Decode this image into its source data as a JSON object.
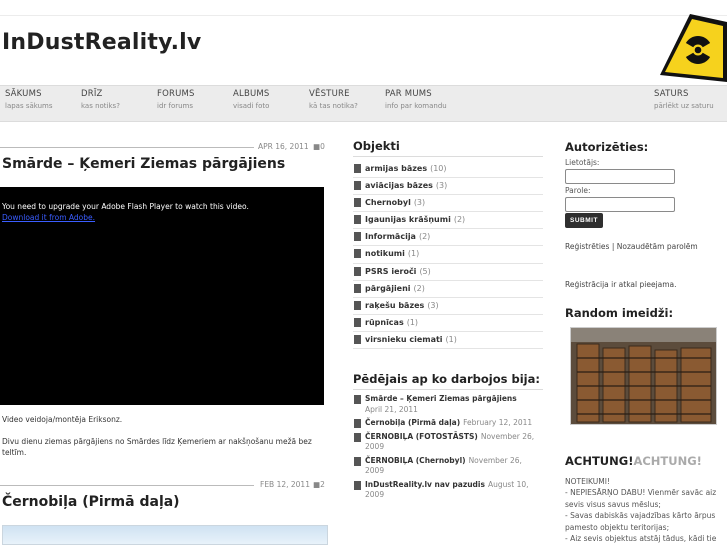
{
  "site": {
    "title": "InDustReality.lv"
  },
  "nav": [
    {
      "title": "SĀKUMS",
      "sub": "lapas sākums"
    },
    {
      "title": "DRĪZ",
      "sub": "kas notiks?"
    },
    {
      "title": "FORUMS",
      "sub": "idr forums"
    },
    {
      "title": "ALBUMS",
      "sub": "visadi foto"
    },
    {
      "title": "VĒSTURE",
      "sub": "kā tas notika?"
    },
    {
      "title": "PAR MUMS",
      "sub": "info par komandu"
    },
    {
      "title": "SATURS",
      "sub": "pārlēkt uz saturu"
    }
  ],
  "posts": [
    {
      "date": "APR 16, 2011",
      "comments": "0",
      "title": "Smārde – Ķemeri Ziemas pārgājiens",
      "video_msg": "You need to upgrade your Adobe Flash Player to watch this video.",
      "video_link": "Download it from Adobe.",
      "credit": "Video veidoja/montēja Eriksonz.",
      "body": "Divu dienu ziemas pārgājiens no Smārdes līdz Ķemeriem ar nakšņošanu mežā bez teltīm."
    },
    {
      "date": "FEB 12, 2011",
      "comments": "2",
      "title": "Černobiļa (Pirmā daļa)"
    }
  ],
  "sidebar": {
    "objekti_title": "Objekti",
    "categories": [
      {
        "name": "armijas bāzes",
        "count": "(10)"
      },
      {
        "name": "aviācijas bāzes",
        "count": "(3)"
      },
      {
        "name": "Chernobyl",
        "count": "(3)"
      },
      {
        "name": "Igaunijas krāšņumi",
        "count": "(2)"
      },
      {
        "name": "Informācija",
        "count": "(2)"
      },
      {
        "name": "notikumi",
        "count": "(1)"
      },
      {
        "name": "PSRS ieroči",
        "count": "(5)"
      },
      {
        "name": "pārgājieni",
        "count": "(2)"
      },
      {
        "name": "raķešu bāzes",
        "count": "(3)"
      },
      {
        "name": "rūpnīcas",
        "count": "(1)"
      },
      {
        "name": "virsnieku ciemati",
        "count": "(1)"
      }
    ],
    "recent_title": "Pēdējais ap ko darbojos bija:",
    "recent": [
      {
        "name": "Smārde – Ķemeri Ziemas pārgājiens",
        "date": "April 21, 2011"
      },
      {
        "name": "Černobiļa (Pirmā daļa)",
        "date": "February 12, 2011"
      },
      {
        "name": "ČERNOBIĻA (FOTOSTĀSTS)",
        "date": "November 26, 2009"
      },
      {
        "name": "ČERNOBIĻA (Chernobyl)",
        "date": "November 26, 2009"
      },
      {
        "name": "InDustReality.lv nav pazudis",
        "date": "August 10, 2009"
      }
    ]
  },
  "right": {
    "auth_title": "Autorizēties:",
    "user_label": "Lietotājs:",
    "pass_label": "Parole:",
    "submit": "SUBMIT",
    "register": "Reģistrēties",
    "separator": "|",
    "forgot": "Nozaudētām parolēm",
    "reg_note": "Reģistrācija ir atkal pieejama.",
    "random_title": "Random imeidži:",
    "achtung_a": "ACHTUNG!",
    "achtung_b": "ACHTUNG!",
    "rules": "NOTEIKUMI!\n- NEPIESĀRŅO DABU! Vienmēr savāc aiz sevis visus savus mēslus;\n- Savas dabiskās vajadzības kārto ārpus pamesto objektu teritorijas;\n- Aiz sevis objektus atstāj tādus, kādi tie"
  },
  "colors": {
    "nav_bg": "#ececec",
    "video_bg": "#000000",
    "link": "#3a5dff",
    "hazard_yellow": "#f6d21d"
  }
}
